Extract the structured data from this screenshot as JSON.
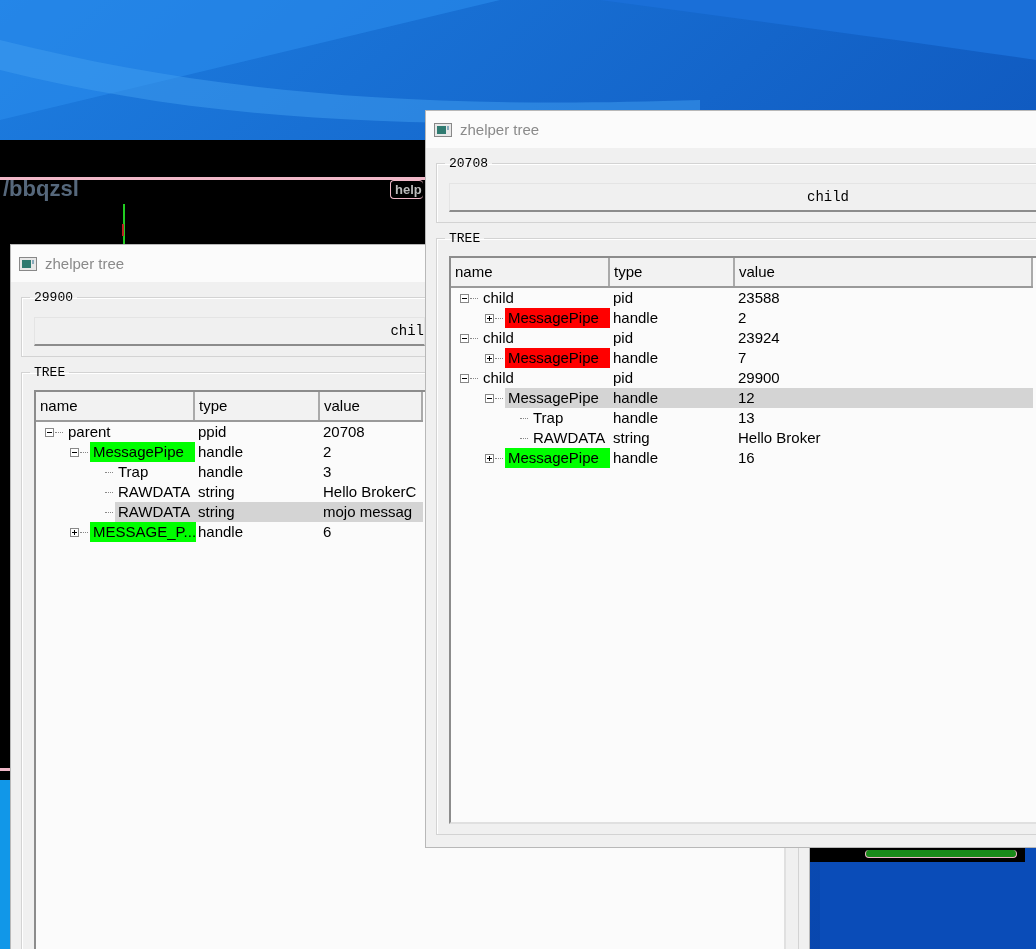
{
  "background_app": {
    "heading": "/bbqzsl",
    "button": "help"
  },
  "windows": [
    {
      "title": "zhelper tree",
      "group_label": "29900",
      "button": "chil",
      "tree_label": "TREE",
      "columns": [
        "name",
        "type",
        "value"
      ],
      "rows": [
        {
          "name": "parent",
          "type": "ppid",
          "value": "20708",
          "kind": "expanded",
          "highlighted": false,
          "children": [
            {
              "name": "MessagePipe",
              "type": "handle",
              "value": "2",
              "kind": "expanded",
              "color": "#00ff00",
              "highlighted": false,
              "children": [
                {
                  "name": "Trap",
                  "type": "handle",
                  "value": "3",
                  "kind": "leaf",
                  "highlighted": false
                },
                {
                  "name": "RAWDATA",
                  "type": "string",
                  "value": "Hello BrokerC",
                  "kind": "leaf",
                  "highlighted": false
                },
                {
                  "name": "RAWDATA",
                  "type": "string",
                  "value": "mojo messag",
                  "kind": "leaf",
                  "highlighted": true
                }
              ]
            },
            {
              "name": "MESSAGE_P...",
              "type": "handle",
              "value": "6",
              "kind": "collapsed",
              "color": "#00ff00",
              "highlighted": false
            }
          ]
        }
      ]
    },
    {
      "title": "zhelper tree",
      "group_label": "20708",
      "button": "child",
      "tree_label": "TREE",
      "columns": [
        "name",
        "type",
        "value"
      ],
      "rows": [
        {
          "name": "child",
          "type": "pid",
          "value": "23588",
          "kind": "expanded",
          "highlighted": false,
          "children": [
            {
              "name": "MessagePipe",
              "type": "handle",
              "value": "2",
              "kind": "collapsed",
              "color": "#ff0000",
              "highlighted": false
            }
          ]
        },
        {
          "name": "child",
          "type": "pid",
          "value": "23924",
          "kind": "expanded",
          "highlighted": false,
          "children": [
            {
              "name": "MessagePipe",
              "type": "handle",
              "value": "7",
              "kind": "collapsed",
              "color": "#ff0000",
              "highlighted": false
            }
          ]
        },
        {
          "name": "child",
          "type": "pid",
          "value": "29900",
          "kind": "expanded",
          "highlighted": false,
          "children": [
            {
              "name": "MessagePipe",
              "type": "handle",
              "value": "12",
              "kind": "expanded",
              "highlighted": true,
              "children": [
                {
                  "name": "Trap",
                  "type": "handle",
                  "value": "13",
                  "kind": "leaf",
                  "highlighted": false
                },
                {
                  "name": "RAWDATA",
                  "type": "string",
                  "value": "Hello Broker",
                  "kind": "leaf",
                  "highlighted": false
                }
              ]
            },
            {
              "name": "MessagePipe",
              "type": "handle",
              "value": "16",
              "kind": "collapsed",
              "color": "#00ff00",
              "highlighted": false
            }
          ]
        }
      ]
    }
  ]
}
